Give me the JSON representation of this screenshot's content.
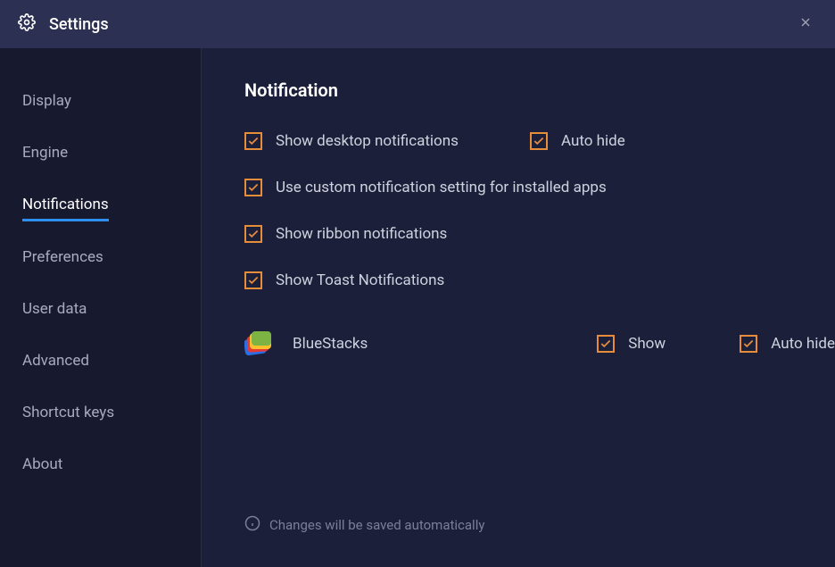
{
  "header": {
    "title": "Settings"
  },
  "sidebar": {
    "items": [
      {
        "label": "Display",
        "active": false
      },
      {
        "label": "Engine",
        "active": false
      },
      {
        "label": "Notifications",
        "active": true
      },
      {
        "label": "Preferences",
        "active": false
      },
      {
        "label": "User data",
        "active": false
      },
      {
        "label": "Advanced",
        "active": false
      },
      {
        "label": "Shortcut keys",
        "active": false
      },
      {
        "label": "About",
        "active": false
      }
    ]
  },
  "content": {
    "title": "Notification",
    "options": {
      "desktop_notifications": "Show desktop notifications",
      "auto_hide": "Auto hide",
      "custom_setting": "Use custom notification setting for installed apps",
      "ribbon_notifications": "Show ribbon notifications",
      "toast_notifications": "Show Toast Notifications"
    },
    "app": {
      "name": "BlueStacks",
      "show_label": "Show",
      "auto_hide_label": "Auto hide"
    }
  },
  "footer": {
    "message": "Changes will be saved automatically"
  }
}
